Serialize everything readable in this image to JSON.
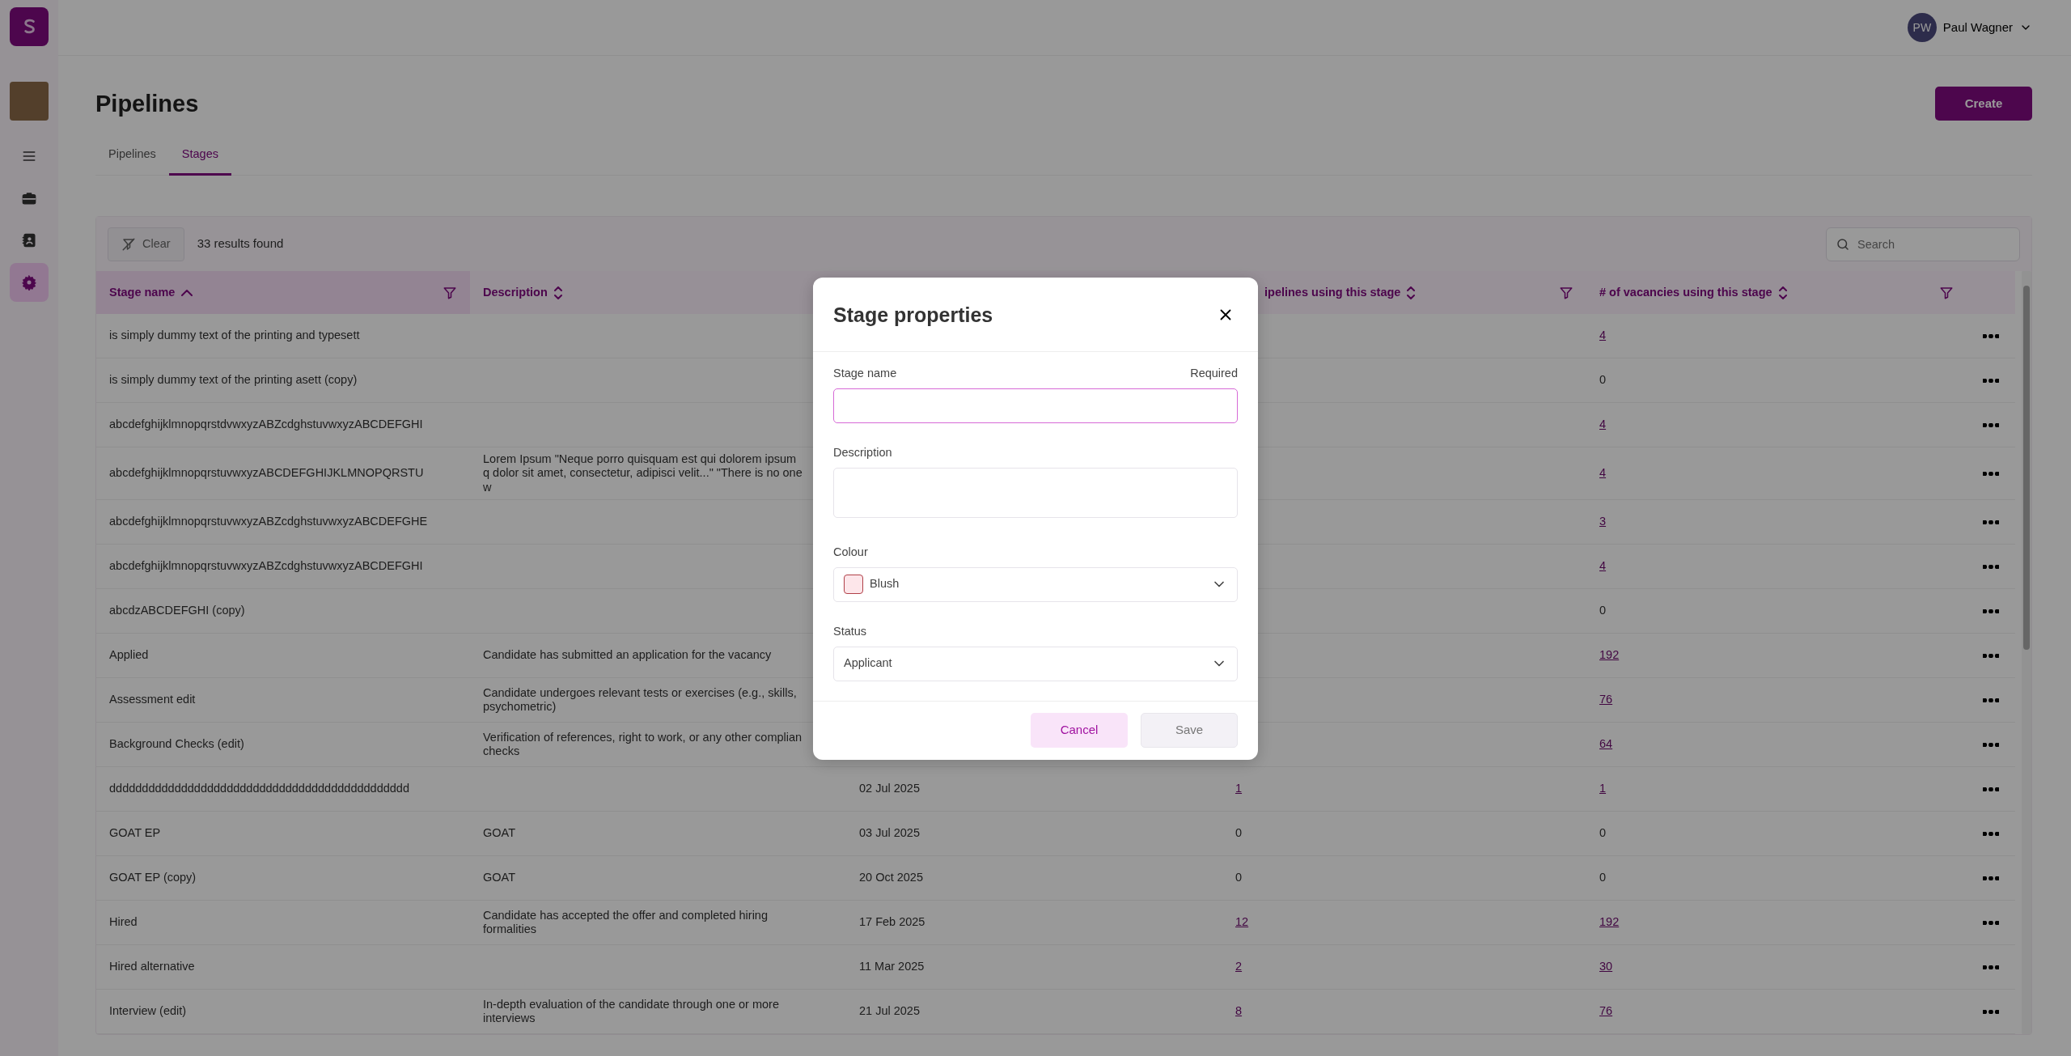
{
  "sidebar": {
    "items": [
      {
        "selected": false
      },
      {
        "selected": false
      },
      {
        "selected": false
      },
      {
        "selected": true
      }
    ]
  },
  "header": {
    "user": {
      "initials": "PW",
      "name": "Paul Wagner"
    }
  },
  "page": {
    "title": "Pipelines",
    "create_button": "Create"
  },
  "tabs": [
    {
      "label": "Pipelines",
      "selected": false
    },
    {
      "label": "Stages",
      "selected": true
    }
  ],
  "toolbar": {
    "clear_button": "Clear",
    "results": "33 results found",
    "search": {
      "placeholder": "Search"
    }
  },
  "table": {
    "columns": [
      {
        "label": "Stage name",
        "sorted": true,
        "filter": true
      },
      {
        "label": "Description",
        "sorted": false,
        "filter": false
      },
      {
        "label": "ipelines using this stage",
        "sorted": false,
        "filter": true
      },
      {
        "label": "# of vacancies using this stage",
        "sorted": false,
        "filter": true
      }
    ],
    "rows": [
      {
        "name": "is simply dummy text of the printing and typesett",
        "vacancies": {
          "text": "4",
          "link": true
        }
      },
      {
        "name": "is simply dummy text of the printing asett (copy)",
        "vacancies": {
          "text": "0",
          "link": false
        }
      },
      {
        "name": "abcdefghijklmnopqrstdvwxyzABZcdghstuvwxyzABCDEFGHI",
        "vacancies": {
          "text": "4",
          "link": true
        }
      },
      {
        "name": "abcdefghijklmnopqrstuvwxyzABCDEFGHIJKLMNOPQRSTU",
        "description": "Lorem Ipsum \"Neque porro quisquam est qui dolorem ipsum q dolor sit amet, consectetur, adipisci velit...\" \"There is no one w",
        "vacancies": {
          "text": "4",
          "link": true
        }
      },
      {
        "name": "abcdefghijklmnopqrstuvwxyzABZcdghstuvwxyzABCDEFGHE",
        "vacancies": {
          "text": "3",
          "link": true
        }
      },
      {
        "name": "abcdefghijklmnopqrstuvwxyzABZcdghstuvwxyzABCDEFGHI",
        "vacancies": {
          "text": "4",
          "link": true
        }
      },
      {
        "name": "abcdzABCDEFGHI (copy)",
        "vacancies": {
          "text": "0",
          "link": false
        }
      },
      {
        "name": "Applied",
        "description": "Candidate has submitted an application for the vacancy",
        "vacancies": {
          "text": "192",
          "link": true
        }
      },
      {
        "name": "Assessment edit",
        "description": "Candidate undergoes relevant tests or exercises (e.g., skills, psychometric)",
        "vacancies": {
          "text": "76",
          "link": true
        }
      },
      {
        "name": "Background Checks (edit)",
        "description": "Verification of references, right to work, or any other complian checks",
        "vacancies": {
          "text": "64",
          "link": true
        }
      },
      {
        "name": "dddddddddddddddddddddddddddddddddddddddddddddd",
        "date": "02 Jul 2025",
        "pipelines": {
          "text": "1",
          "link": true
        },
        "vacancies": {
          "text": "1",
          "link": true
        }
      },
      {
        "name": "GOAT EP",
        "description": "GOAT",
        "date": "03 Jul 2025",
        "pipelines": {
          "text": "0",
          "link": false
        },
        "vacancies": {
          "text": "0",
          "link": false
        }
      },
      {
        "name": "GOAT EP (copy)",
        "description": "GOAT",
        "date": "20 Oct 2025",
        "pipelines": {
          "text": "0",
          "link": false
        },
        "vacancies": {
          "text": "0",
          "link": false
        }
      },
      {
        "name": "Hired",
        "description": "Candidate has accepted the offer and completed hiring formalities",
        "date": "17 Feb 2025",
        "pipelines": {
          "text": "12",
          "link": true
        },
        "vacancies": {
          "text": "192",
          "link": true
        }
      },
      {
        "name": "Hired alternative",
        "date": "11 Mar 2025",
        "pipelines": {
          "text": "2",
          "link": true
        },
        "vacancies": {
          "text": "30",
          "link": true
        }
      },
      {
        "name": "Interview (edit)",
        "description": "In-depth evaluation of the candidate through one or more interviews",
        "date": "21 Jul 2025",
        "pipelines": {
          "text": "8",
          "link": true
        },
        "vacancies": {
          "text": "76",
          "link": true
        }
      }
    ]
  },
  "dialog": {
    "title": "Stage properties",
    "fields": [
      {
        "kind": "text",
        "label": "Stage name",
        "hint": "Required",
        "focused": true
      },
      {
        "kind": "textarea",
        "label": "Description"
      },
      {
        "kind": "colour",
        "label": "Colour",
        "value": "Blush",
        "color": "#fde6ea"
      },
      {
        "kind": "select",
        "label": "Status",
        "value": "Applicant"
      }
    ],
    "buttons": [
      {
        "label": "Cancel",
        "kind": "secondary",
        "disabled": false
      },
      {
        "label": "Save",
        "kind": "primary",
        "disabled": true
      }
    ]
  }
}
